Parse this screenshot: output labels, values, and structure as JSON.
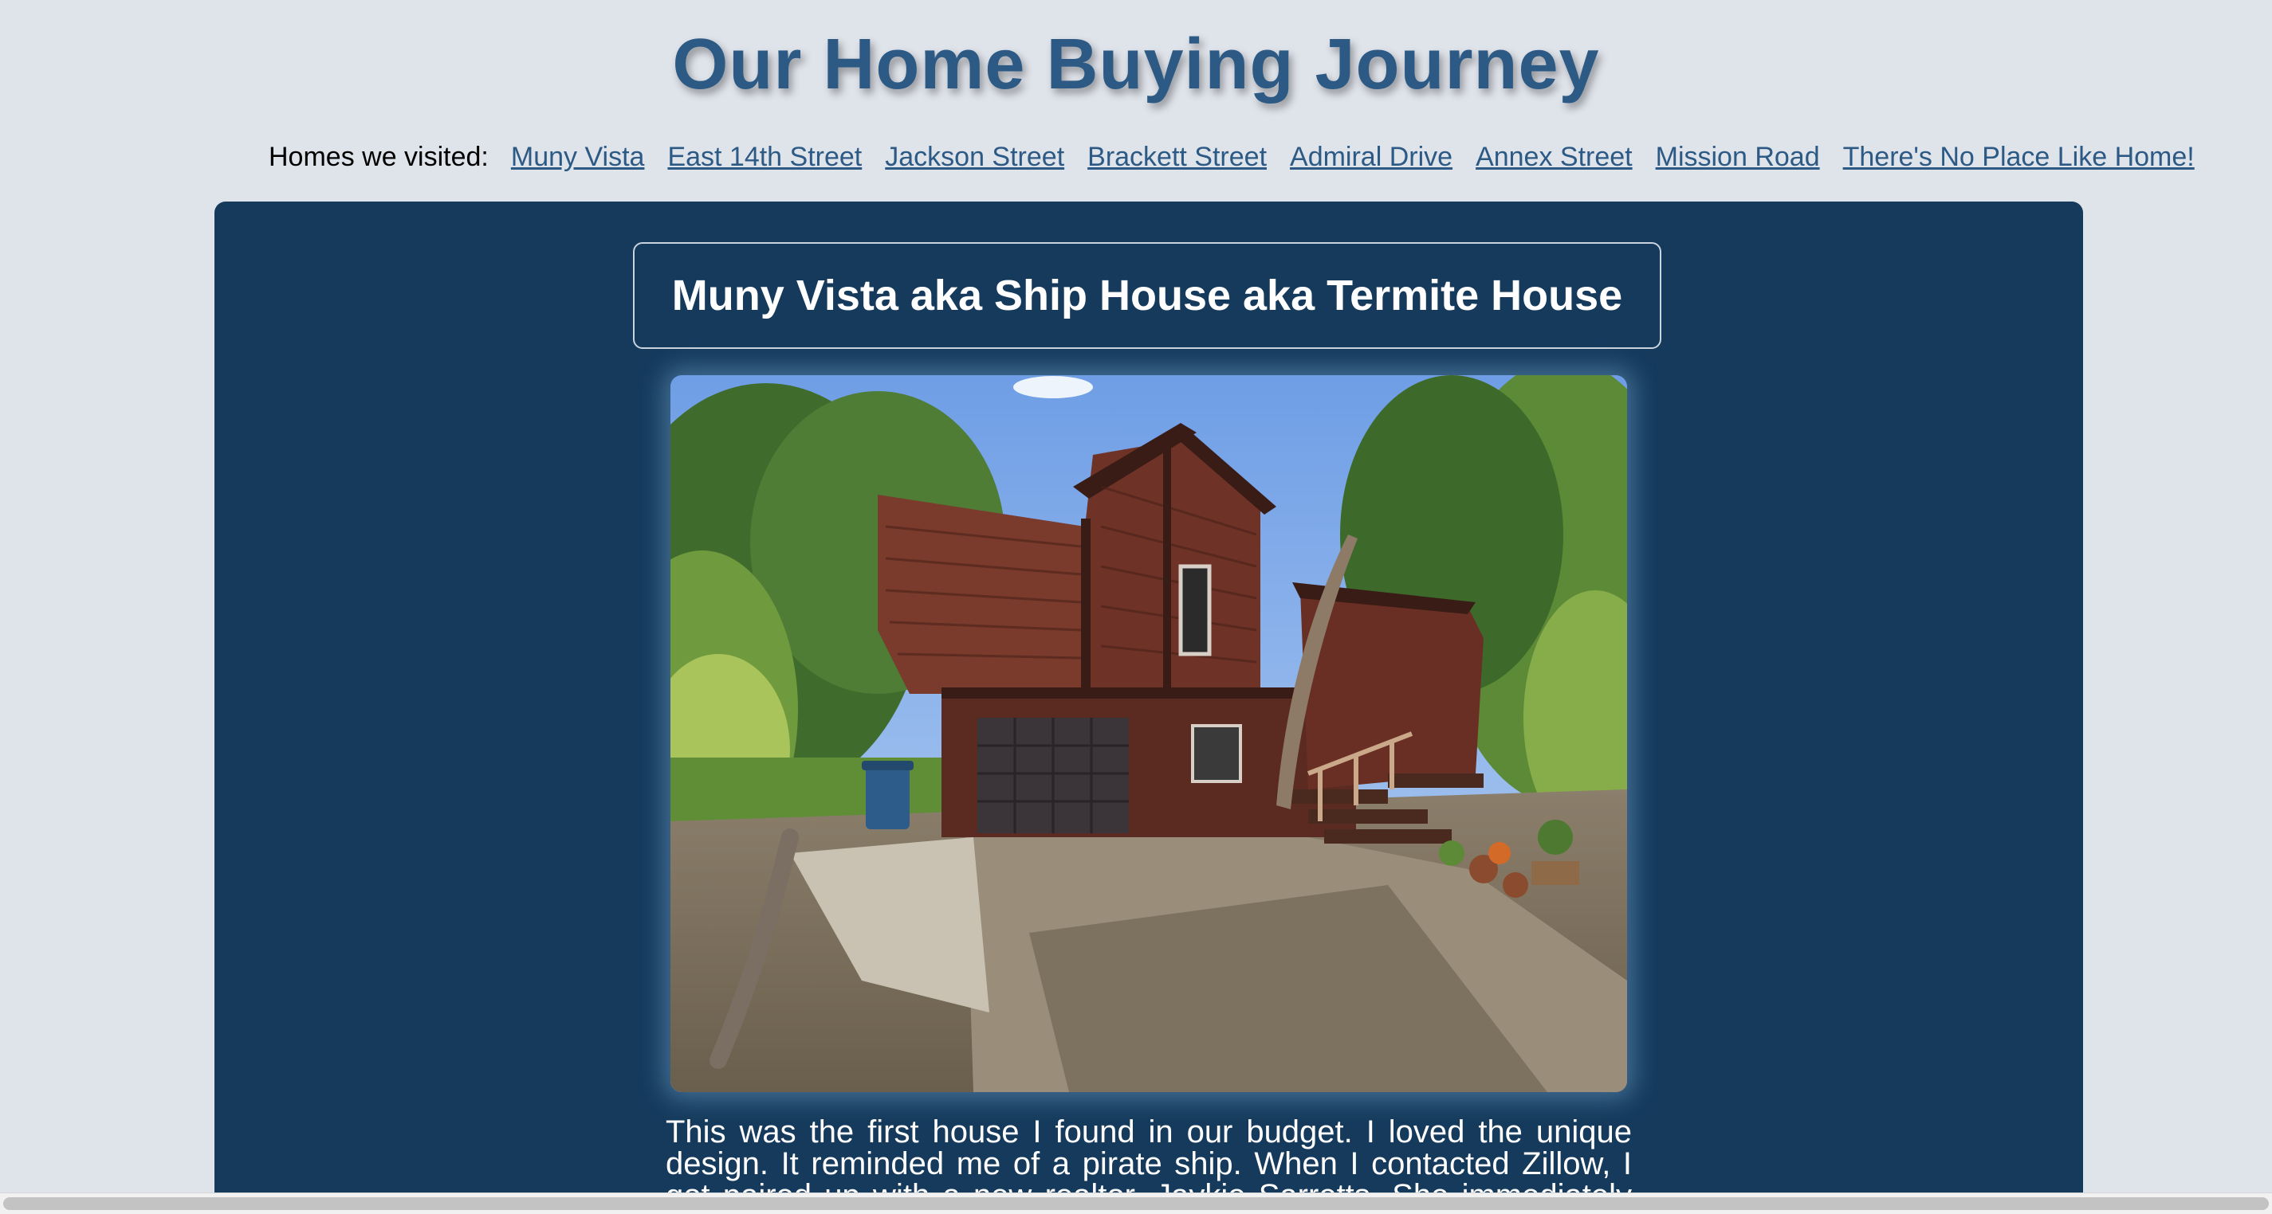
{
  "site": {
    "title": "Our Home Buying Journey"
  },
  "nav": {
    "label": "Homes we visited:",
    "links": [
      "Muny Vista",
      "East 14th Street",
      "Jackson Street",
      "Brackett Street",
      "Admiral Drive",
      "Annex Street",
      "Mission Road",
      "There's No Place Like Home!"
    ]
  },
  "house": {
    "title": "Muny Vista aka Ship House aka Termite House",
    "photo_description": "wood-sided-house-exterior-photo",
    "description": "This was the first house I found in our budget. I loved the unique design. It reminded me of a pirate ship. When I contacted Zillow, I got paired up with a new realtor, Jaykie Sarretts. She immediately told"
  },
  "colors": {
    "page_background": "#dfe3ea",
    "title_color": "#2c5a85",
    "link_color": "#2c5a85",
    "card_background": "#153a5c",
    "text_light": "#ffffff"
  }
}
